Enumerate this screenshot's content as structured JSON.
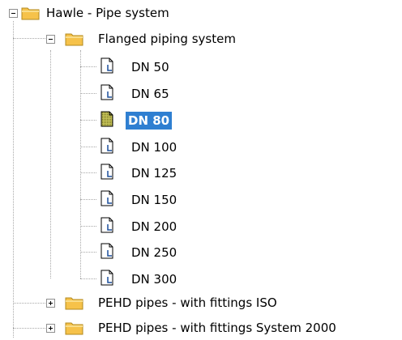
{
  "tree": {
    "root": {
      "label": "Hawle - Pipe system",
      "expanded": true,
      "icon": "folder-icon"
    },
    "group_flanged": {
      "label": "Flanged piping system",
      "expanded": true,
      "icon": "folder-icon"
    },
    "items": [
      {
        "label": "DN 50",
        "icon": "document-icon"
      },
      {
        "label": "DN 65",
        "icon": "document-icon"
      },
      {
        "label": "DN 80",
        "icon": "document-selected-icon",
        "selected": true
      },
      {
        "label": "DN 100",
        "icon": "document-icon"
      },
      {
        "label": "DN 125",
        "icon": "document-icon"
      },
      {
        "label": "DN 150",
        "icon": "document-icon"
      },
      {
        "label": "DN 200",
        "icon": "document-icon"
      },
      {
        "label": "DN 250",
        "icon": "document-icon"
      },
      {
        "label": "DN 300",
        "icon": "document-icon"
      }
    ],
    "group_pehd_iso": {
      "label": "PEHD pipes - with fittings ISO",
      "expanded": false,
      "icon": "folder-icon"
    },
    "group_pehd_2000": {
      "label": "PEHD pipes - with fittings System 2000",
      "expanded": false,
      "icon": "folder-icon"
    }
  },
  "colors": {
    "selection": "#2f7fd1",
    "folder_fill": "#f6c24a",
    "folder_tab": "#f9dd8a",
    "folder_stroke": "#b38a1d",
    "tree_lines": "#a8a8a8"
  }
}
